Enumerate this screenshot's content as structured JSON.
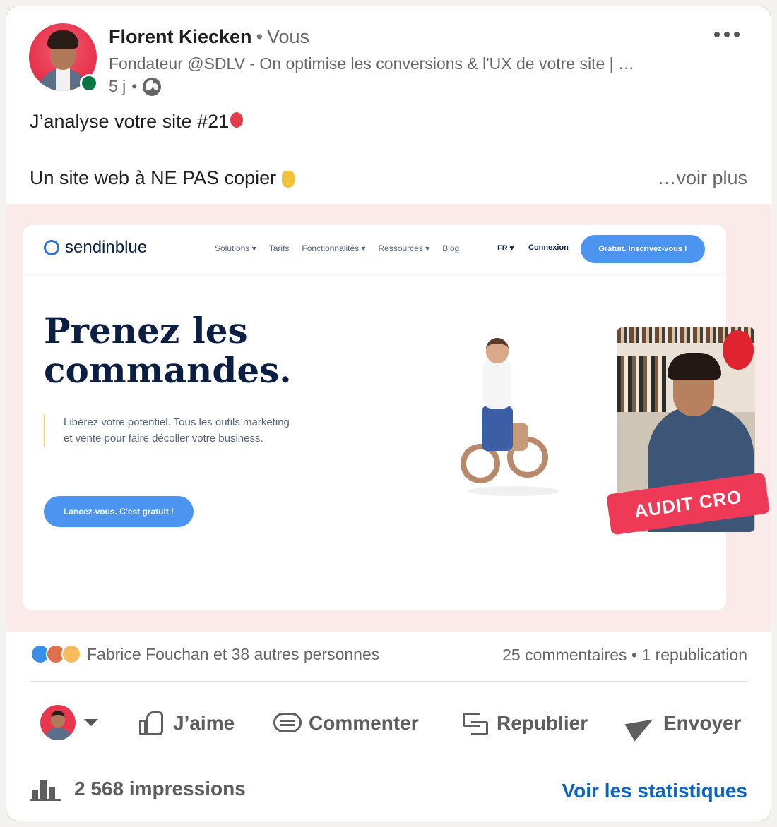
{
  "post": {
    "author": "Florent Kiecken",
    "separator": "•",
    "relation": "Vous",
    "headline": "Fondateur @SDLV - On optimise les conversions & l'UX de votre site | …",
    "time": "5 j",
    "time_sep": "•",
    "line1": "J’analyse votre site #21",
    "line2": "Un site web à NE PAS copier",
    "see_more": "…voir plus"
  },
  "media": {
    "brand": "sendinblue",
    "nav": [
      "Solutions ▾",
      "Tarifs",
      "Fonctionnalités ▾",
      "Ressources ▾",
      "Blog"
    ],
    "lang": "FR ▾",
    "login": "Connexion",
    "nav_cta": "Gratuit. Inscrivez-vous !",
    "hero_title": "Prenez les commandes.",
    "hero_sub": "Libérez votre potentiel. Tous les outils marketing et vente pour faire décoller votre business.",
    "hero_cta": "Lancez-vous. C'est gratuit !",
    "badge": "AUDIT CRO"
  },
  "social": {
    "reactions_text": "Fabrice Fouchan et 38 autres personnes",
    "comments": "25 commentaires",
    "counts_sep": "•",
    "reposts": "1 republication"
  },
  "actions": {
    "like": "J’aime",
    "comment": "Commenter",
    "repost": "Republier",
    "send": "Envoyer"
  },
  "footer": {
    "impressions": "2 568 impressions",
    "stats_link": "Voir les statistiques"
  },
  "colors": {
    "link": "#0a66c2",
    "online": "#057642",
    "accent": "#4b95f0",
    "badge": "#ee3a56"
  },
  "icons": [
    "more-icon",
    "globe-icon",
    "balloon-icon",
    "pointing-down-icon",
    "like-icon",
    "love-icon",
    "insight-icon",
    "thumb-icon",
    "comment-icon",
    "repost-icon",
    "send-icon",
    "chart-icon"
  ]
}
